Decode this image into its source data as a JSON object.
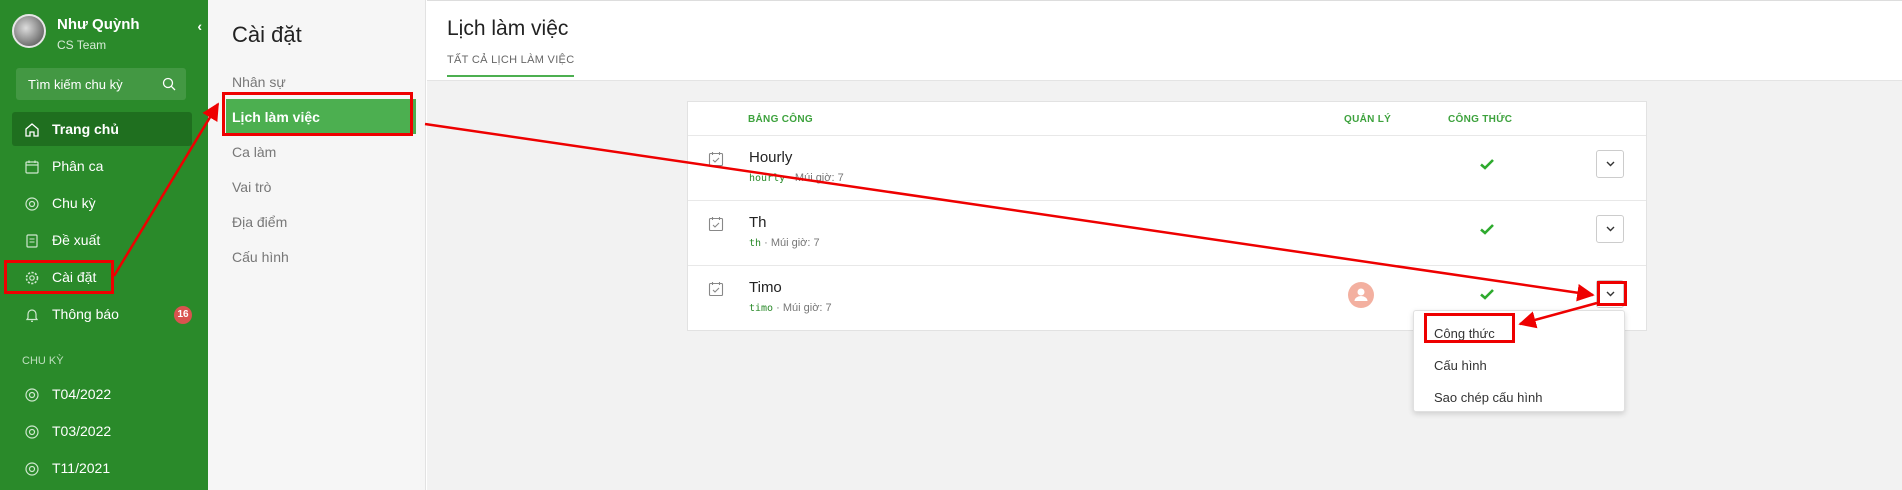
{
  "sidebar": {
    "profile_name": "Như Quỳnh",
    "profile_team": "CS Team",
    "search_placeholder": "Tìm kiếm chu kỳ",
    "nav": [
      {
        "label": "Trang chủ",
        "icon": "home-icon"
      },
      {
        "label": "Phân ca",
        "icon": "calendar-icon"
      },
      {
        "label": "Chu kỳ",
        "icon": "cycle-icon"
      },
      {
        "label": "Đề xuất",
        "icon": "document-icon"
      },
      {
        "label": "Cài đặt",
        "icon": "gear-icon"
      },
      {
        "label": "Thông báo",
        "icon": "bell-icon",
        "badge": "16"
      }
    ],
    "section_label": "CHU KỲ",
    "cycles": [
      "T04/2022",
      "T03/2022",
      "T11/2021"
    ]
  },
  "settings": {
    "title": "Cài đặt",
    "items": [
      "Nhân sự",
      "Lịch làm việc",
      "Ca làm",
      "Vai trò",
      "Địa điểm",
      "Cấu hình"
    ]
  },
  "main": {
    "title": "Lịch làm việc",
    "tab": "TẤT CẢ LỊCH LÀM VIỆC",
    "columns": {
      "name": "BẢNG CÔNG",
      "manager": "QUẢN LÝ",
      "formula": "CÔNG THỨC"
    },
    "rows": [
      {
        "name": "Hourly",
        "code": "hourly",
        "tz": "· Múi giờ: 7"
      },
      {
        "name": "Th",
        "code": "th",
        "tz": "· Múi giờ: 7"
      },
      {
        "name": "Timo",
        "code": "timo",
        "tz": "· Múi giờ: 7"
      }
    ],
    "menu": [
      "Công thức",
      "Cấu hình",
      "Sao chép cấu hình"
    ]
  },
  "colors": {
    "sidebar": "#2a8a2a",
    "accent": "#4caf50",
    "annotation": "#e00000"
  }
}
